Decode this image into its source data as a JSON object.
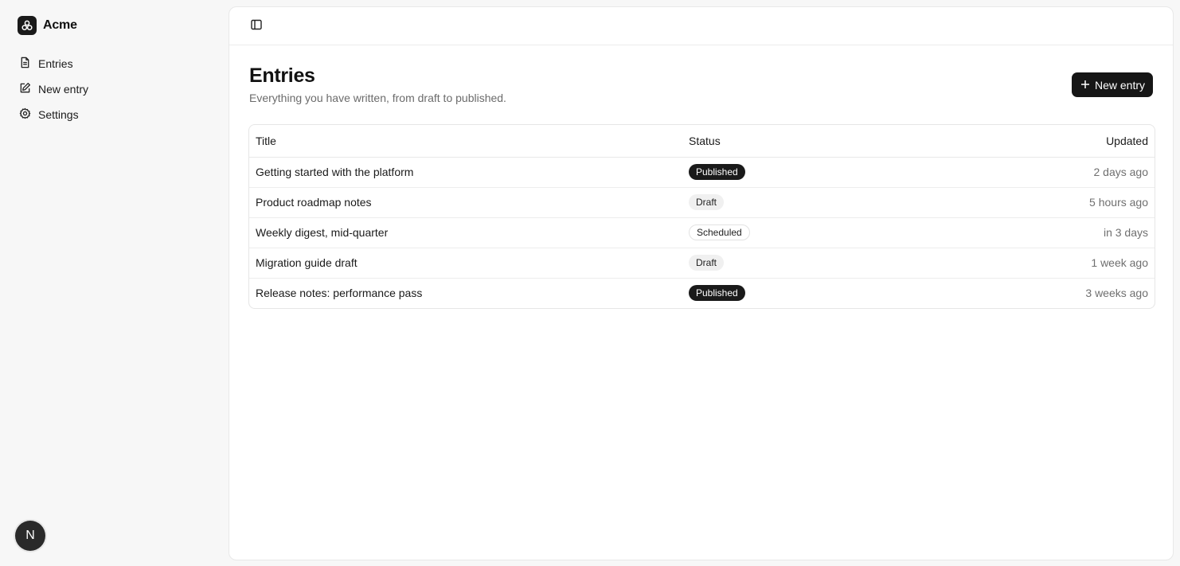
{
  "brand": {
    "name": "Acme"
  },
  "sidebar": {
    "items": [
      {
        "label": "Entries",
        "icon": "file-text-icon"
      },
      {
        "label": "New entry",
        "icon": "edit-icon"
      },
      {
        "label": "Settings",
        "icon": "gear-icon"
      }
    ],
    "avatar_initial": "N"
  },
  "header": {
    "toggle_icon": "sidebar-toggle-icon"
  },
  "page": {
    "title": "Entries",
    "subtitle": "Everything you have written, from draft to published.",
    "new_button_label": "New entry"
  },
  "table": {
    "columns": {
      "title": "Title",
      "status": "Status",
      "updated": "Updated"
    },
    "rows": [
      {
        "title": "Getting started with the platform",
        "status": "Published",
        "updated": "2 days ago"
      },
      {
        "title": "Product roadmap notes",
        "status": "Draft",
        "updated": "5 hours ago"
      },
      {
        "title": "Weekly digest, mid-quarter",
        "status": "Scheduled",
        "updated": "in 3 days"
      },
      {
        "title": "Migration guide draft",
        "status": "Draft",
        "updated": "1 week ago"
      },
      {
        "title": "Release notes: performance pass",
        "status": "Published",
        "updated": "3 weeks ago"
      }
    ]
  },
  "colors": {
    "primary": "#161616",
    "page_bg": "#f7f7f7",
    "panel_bg": "#ffffff",
    "muted_text": "#6b6b6b"
  }
}
